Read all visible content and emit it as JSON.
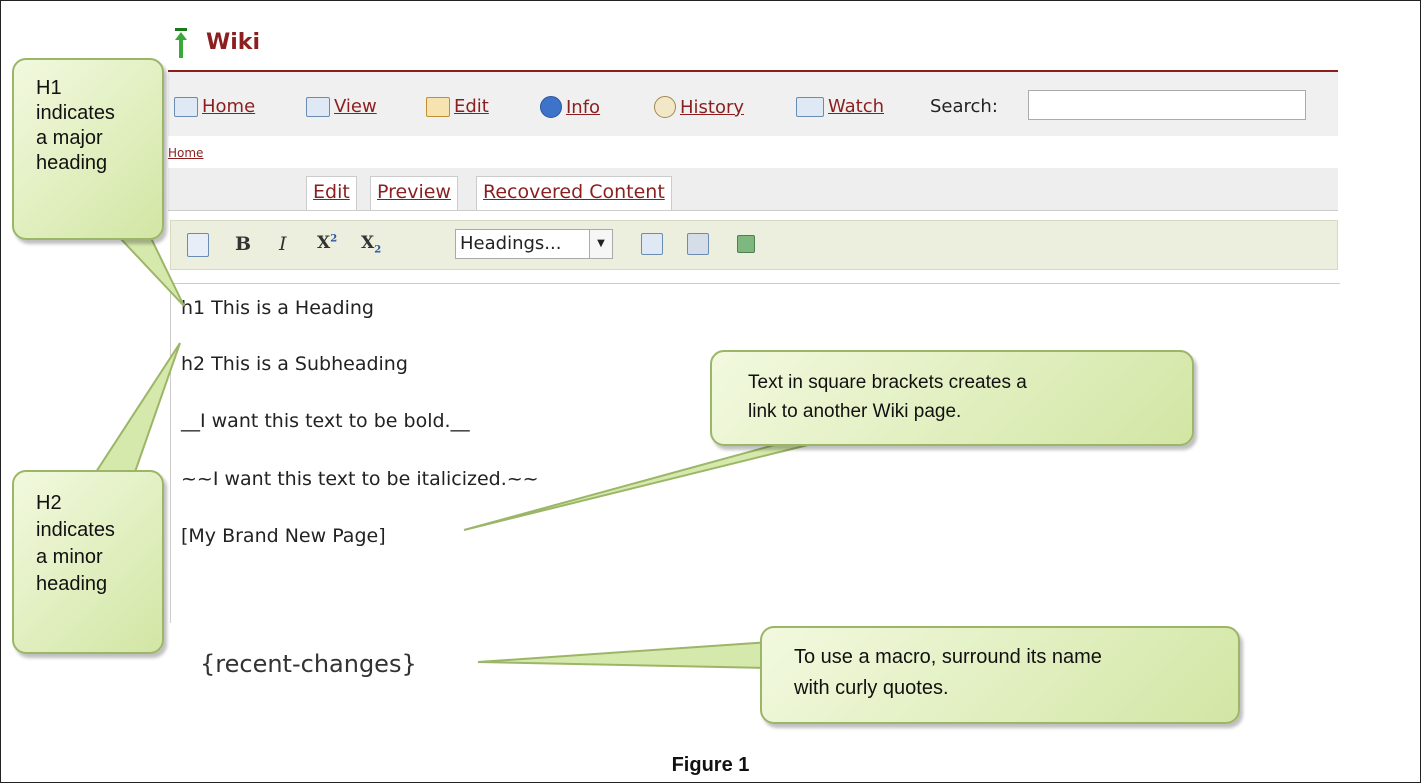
{
  "wiki": {
    "title": "Wiki",
    "nav": [
      {
        "label": "Home",
        "icon": "home-icon"
      },
      {
        "label": "View",
        "icon": "view-icon"
      },
      {
        "label": "Edit",
        "icon": "edit-icon"
      },
      {
        "label": "Info",
        "icon": "info-icon"
      },
      {
        "label": "History",
        "icon": "history-icon"
      },
      {
        "label": "Watch",
        "icon": "watch-icon"
      }
    ],
    "search_label": "Search:",
    "search_value": "",
    "breadcrumb": "Home",
    "tabs": [
      "Edit",
      "Preview",
      "Recovered Content"
    ],
    "toolbar": {
      "bold": "B",
      "italic": "I",
      "superscript": "X",
      "superscript_mark": "2",
      "subscript": "X",
      "subscript_mark": "2",
      "headings_select": "Headings..."
    },
    "editor_lines": [
      "h1 This is a Heading",
      "h2 This is a Subheading",
      "__I want this text to be bold.__",
      "~~I want this text to be italicized.~~",
      "[My Brand New Page]"
    ],
    "macro": "{recent-changes}"
  },
  "callouts": {
    "h1": [
      "H1",
      "indicates",
      "a major",
      "heading"
    ],
    "h2": [
      "H2",
      "indicates",
      "a minor",
      "heading"
    ],
    "link": [
      "Text in square brackets creates a",
      "link to another Wiki page."
    ],
    "macro": [
      "To use a macro, surround its name",
      "with curly quotes."
    ]
  },
  "caption": "Figure 1",
  "colors": {
    "brand": "#8b1f1f",
    "callout_fill": "#dfeebb",
    "callout_border": "#9cb667",
    "toolbar_bg": "#ecefdd"
  }
}
